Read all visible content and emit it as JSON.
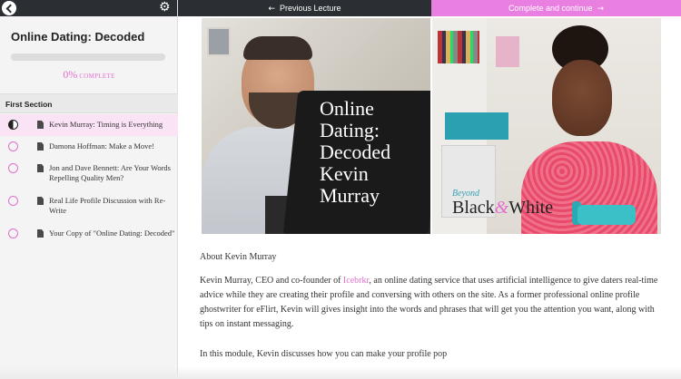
{
  "sidebar": {
    "course_title": "Online Dating: Decoded",
    "progress_percent": 0,
    "progress_pct_text": "0%",
    "progress_label": "COMPLETE",
    "section_title": "First Section",
    "lessons": [
      {
        "title": "Kevin Murray: Timing is Everything",
        "status": "in-progress"
      },
      {
        "title": "Damona Hoffman: Make a Move!",
        "status": "not-started"
      },
      {
        "title": "Jon and Dave Bennett: Are Your Words Repelling Quality Men?",
        "status": "not-started"
      },
      {
        "title": "Real Life Profile Discussion with Re-Write",
        "status": "not-started"
      },
      {
        "title": "Your Copy of \"Online Dating: Decoded\"",
        "status": "not-started"
      }
    ]
  },
  "topbar": {
    "prev_label": "Previous Lecture",
    "next_label": "Complete and continue"
  },
  "hero": {
    "overlay_title": "Online Dating: Decoded Kevin Murray",
    "brand_small": "Beyond",
    "brand_big_1": "Black",
    "brand_amp": "&",
    "brand_big_2": "White"
  },
  "content": {
    "about_heading": "About Kevin Murray",
    "p1_before": "Kevin Murray, CEO and co-founder of ",
    "p1_link": "Icebrkr",
    "p1_after": ", an online dating service that uses artificial intelligence to give daters real-time advice while they are creating their profile and conversing with others on the site. As a former professional online profile ghostwriter for eFlirt, Kevin will gives insight into the words and phrases that will get you the attention you want, along with tips on instant messaging.",
    "p2": "In this module, Kevin discusses how you can make your profile pop"
  },
  "colors": {
    "accent": "#e26fcf",
    "dark": "#2b2f33",
    "next_button": "#e97fe0"
  },
  "icons": {
    "back": "chevron-left-icon",
    "settings": "gear-icon",
    "lesson": "document-icon"
  }
}
